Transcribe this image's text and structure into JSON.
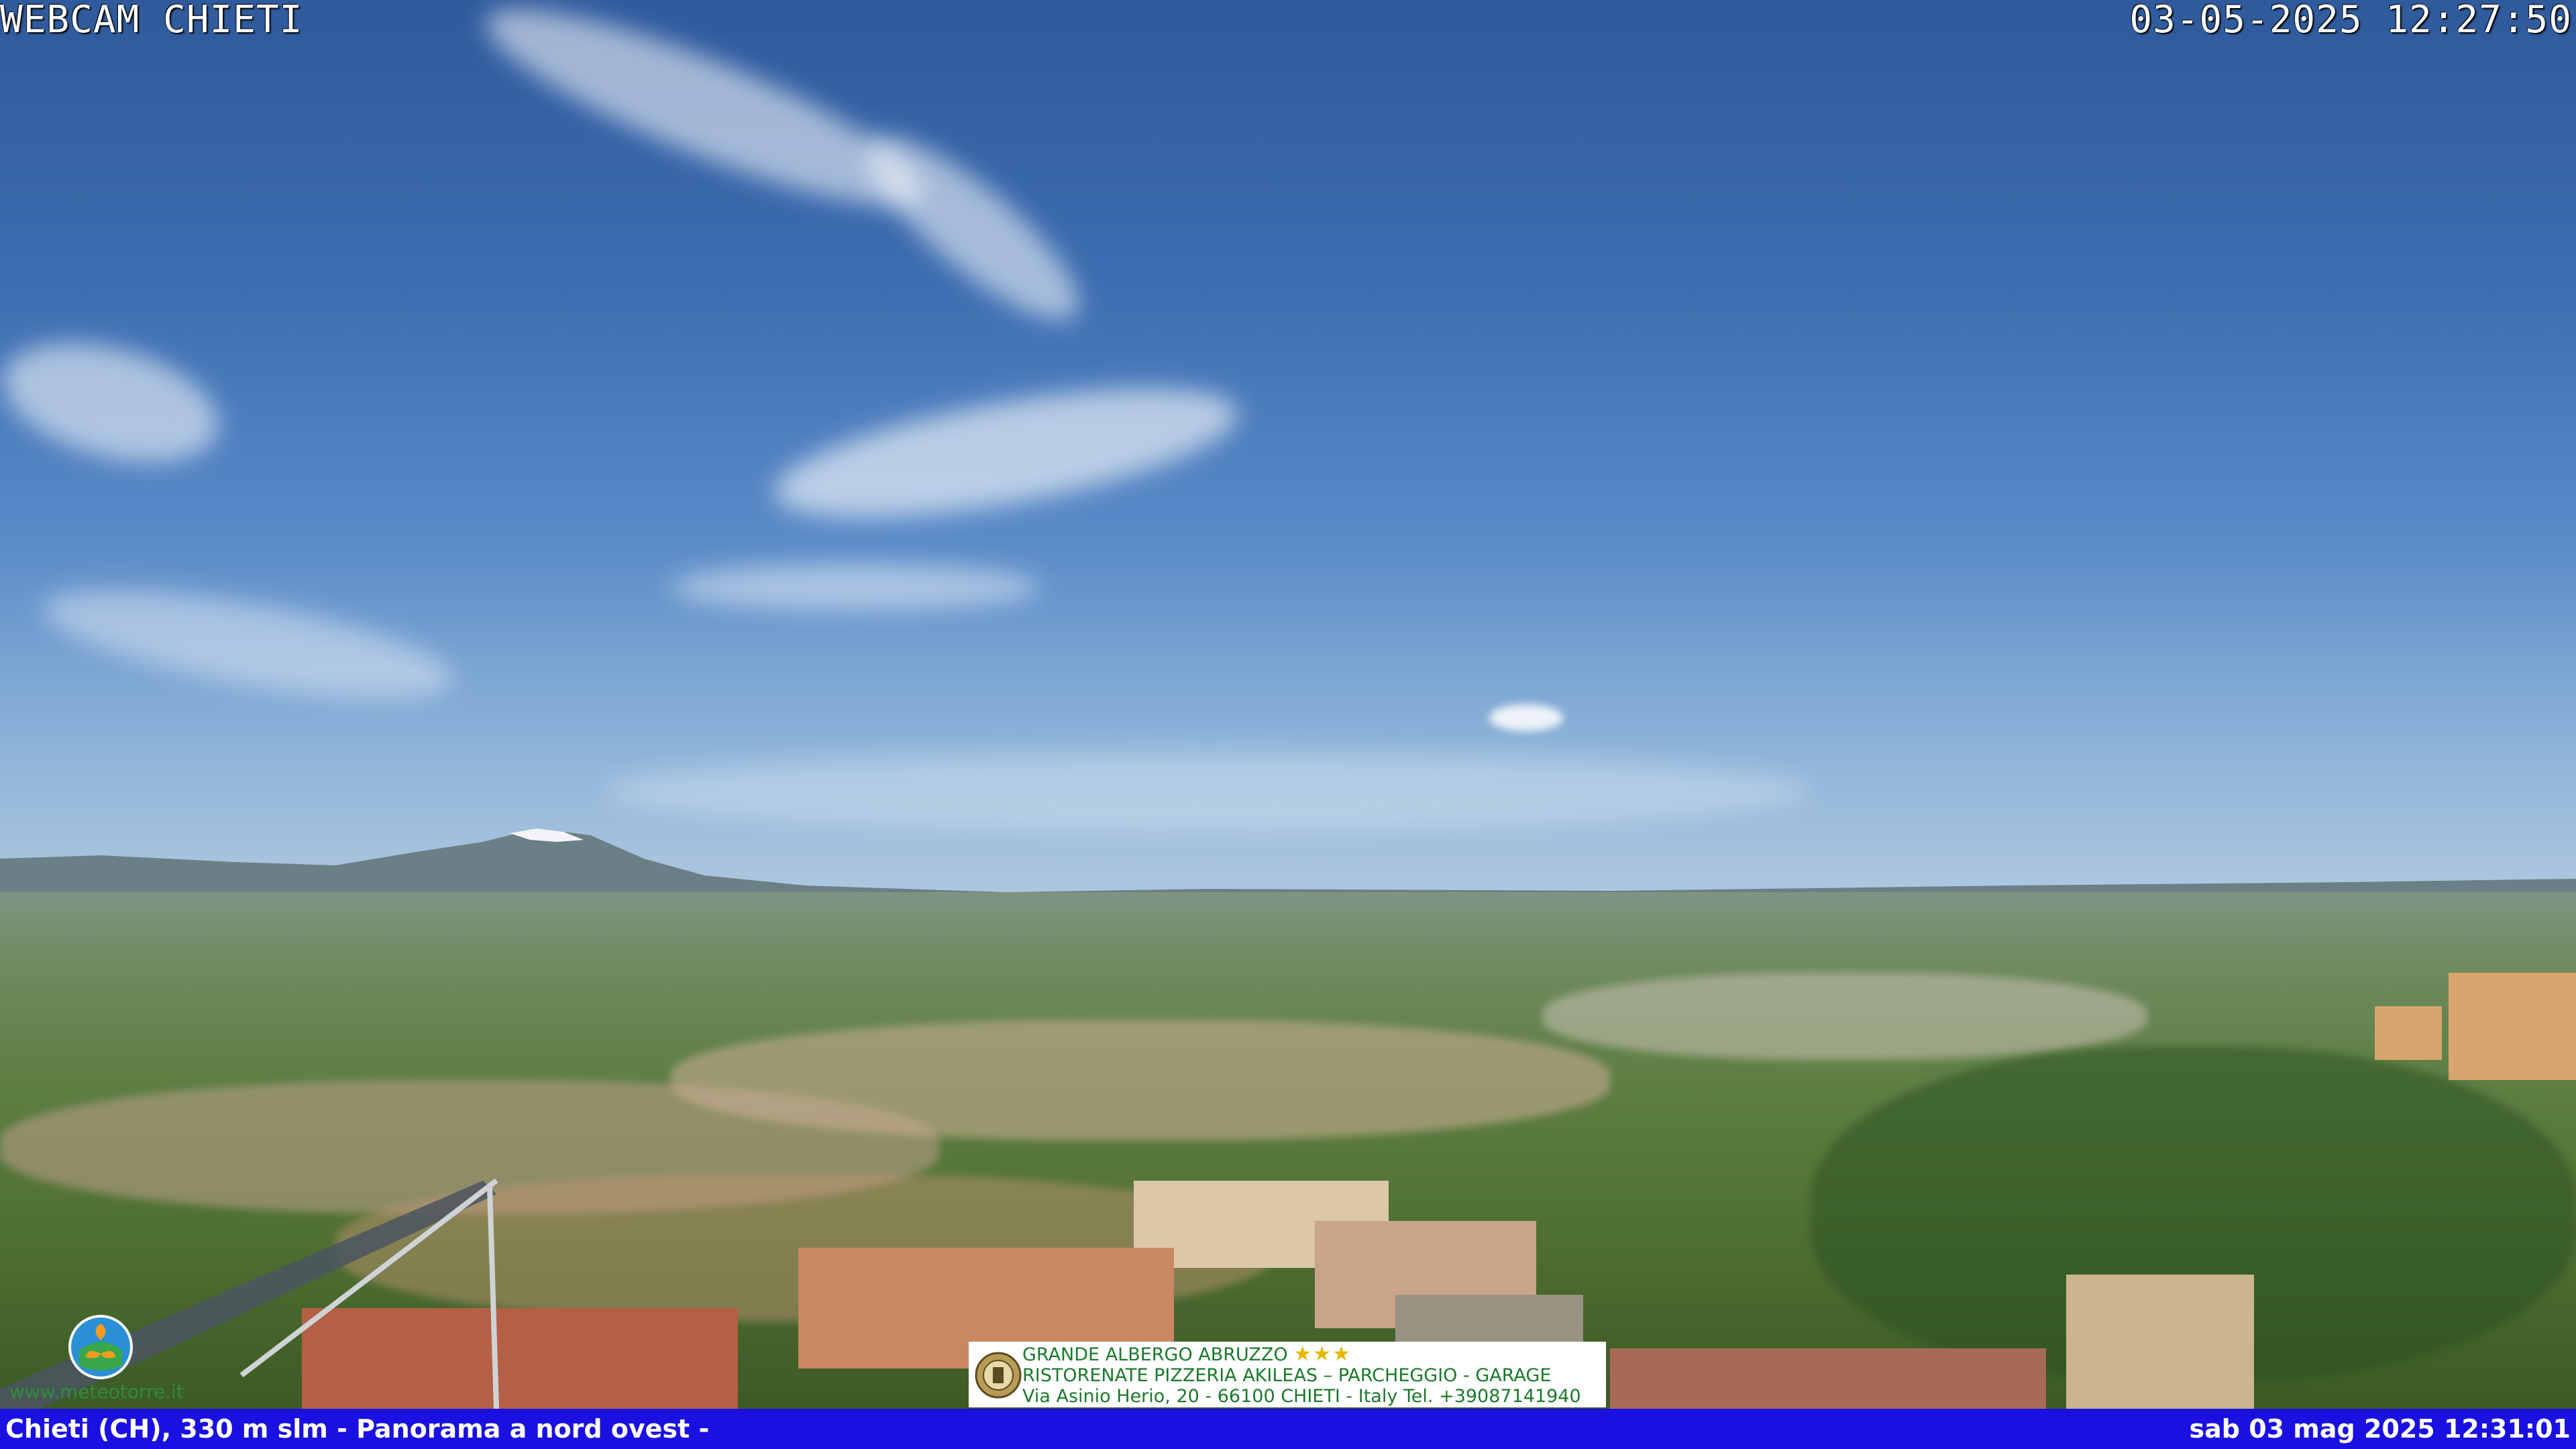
{
  "overlay": {
    "title": "WEBCAM CHIETI",
    "capture_time": "03-05-2025 12:27:50"
  },
  "bottom_bar": {
    "location": "Chieti (CH), 330 m slm - Panorama a nord ovest -",
    "datetime": "sab 03 mag 2025 12:31:01",
    "color": "#1a10e0"
  },
  "advert": {
    "line1": "GRANDE ALBERGO ABRUZZO",
    "stars": "★★★",
    "line2": "RISTORENATE PIZZERIA AKILEAS – PARCHEGGIO - GARAGE",
    "line3": "Via Asinio Herio, 20 - 66100 CHIETI - Italy Tel. +39087141940",
    "emblem_icon": "crest-icon"
  },
  "logo": {
    "text": "www.meteotorre.it",
    "icon": "meteotorre-logo-icon"
  }
}
